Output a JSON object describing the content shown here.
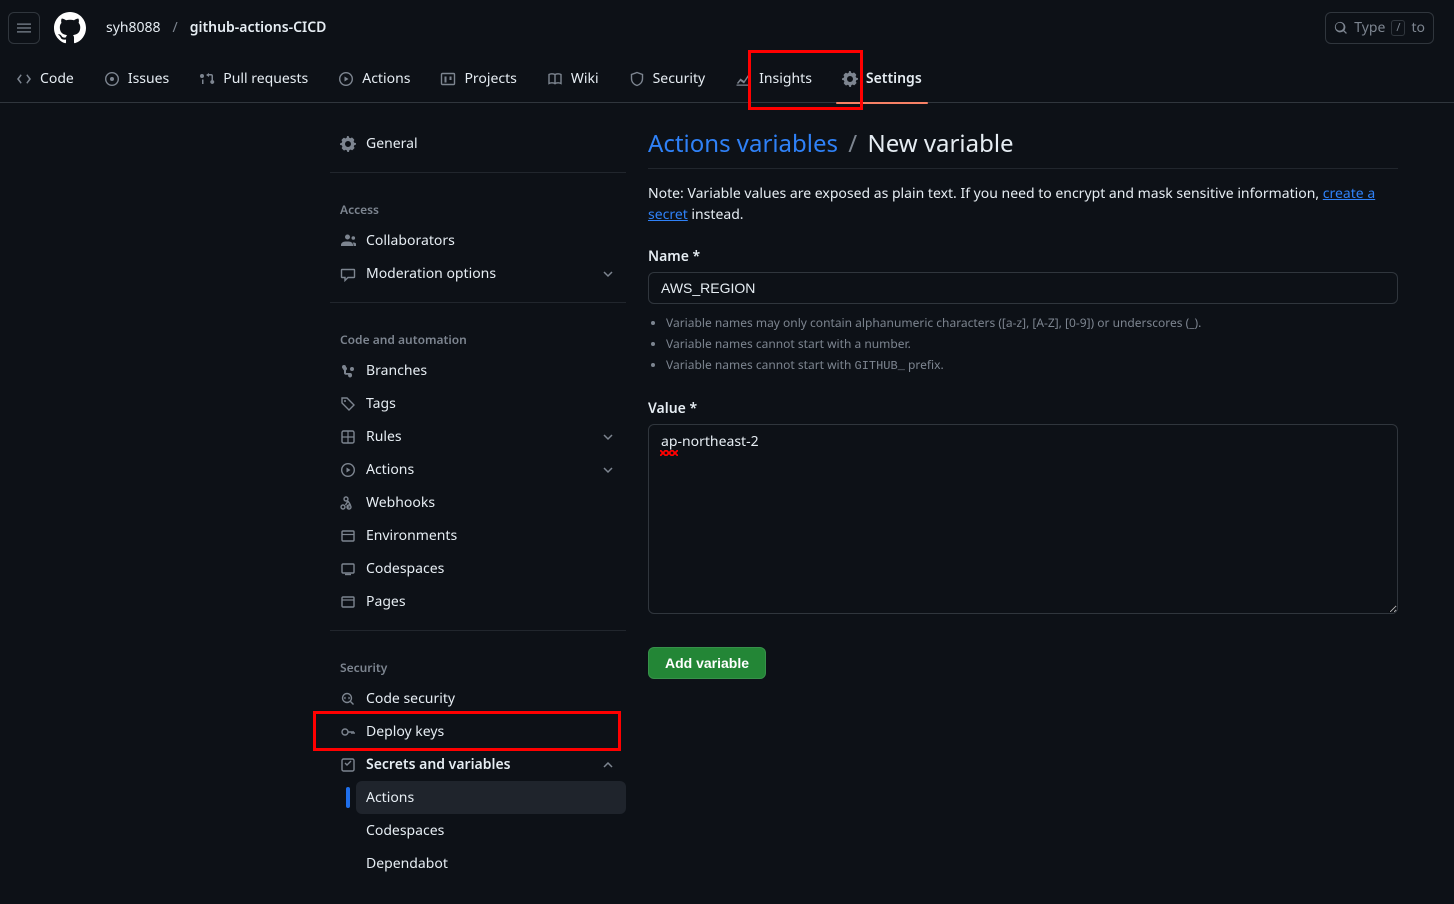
{
  "header": {
    "owner": "syh8088",
    "repo": "github-actions-CICD",
    "search_placeholder": "Type",
    "search_shortcut": "/",
    "search_suffix": "to"
  },
  "repo_tabs": [
    {
      "icon": "code",
      "label": "Code"
    },
    {
      "icon": "issue",
      "label": "Issues"
    },
    {
      "icon": "pr",
      "label": "Pull requests"
    },
    {
      "icon": "play",
      "label": "Actions"
    },
    {
      "icon": "project",
      "label": "Projects"
    },
    {
      "icon": "book",
      "label": "Wiki"
    },
    {
      "icon": "shield",
      "label": "Security"
    },
    {
      "icon": "graph",
      "label": "Insights"
    },
    {
      "icon": "gear",
      "label": "Settings"
    }
  ],
  "sidebar": {
    "general": "General",
    "sections": {
      "access": {
        "title": "Access",
        "items": [
          {
            "icon": "people",
            "label": "Collaborators"
          },
          {
            "icon": "comment",
            "label": "Moderation options",
            "chev": true
          }
        ]
      },
      "code_automation": {
        "title": "Code and automation",
        "items": [
          {
            "icon": "branch",
            "label": "Branches"
          },
          {
            "icon": "tag",
            "label": "Tags"
          },
          {
            "icon": "rules",
            "label": "Rules",
            "chev": true
          },
          {
            "icon": "play",
            "label": "Actions",
            "chev": true
          },
          {
            "icon": "webhook",
            "label": "Webhooks"
          },
          {
            "icon": "env",
            "label": "Environments"
          },
          {
            "icon": "codesp",
            "label": "Codespaces"
          },
          {
            "icon": "browser",
            "label": "Pages"
          }
        ]
      },
      "security": {
        "title": "Security",
        "items": [
          {
            "icon": "codescan",
            "label": "Code security"
          },
          {
            "icon": "key",
            "label": "Deploy keys"
          },
          {
            "icon": "lock",
            "label": "Secrets and variables",
            "chev": "up",
            "bold": true
          }
        ],
        "sub": [
          {
            "label": "Actions",
            "active": true
          },
          {
            "label": "Codespaces"
          },
          {
            "label": "Dependabot"
          }
        ]
      }
    }
  },
  "main": {
    "title_link": "Actions variables",
    "title_current": "New variable",
    "note_prefix": "Note: Variable values are exposed as plain text. If you need to encrypt and mask sensitive information, ",
    "note_link": "create a secret",
    "note_suffix": " instead.",
    "name_label": "Name *",
    "name_value": "AWS_REGION",
    "hints": [
      "Variable names may only contain alphanumeric characters ([a-z], [A-Z], [0-9]) or underscores (_).",
      "Variable names cannot start with a number.",
      "Variable names cannot start with GITHUB_ prefix."
    ],
    "value_label": "Value *",
    "value_value": "ap-northeast-2",
    "submit_label": "Add variable"
  }
}
